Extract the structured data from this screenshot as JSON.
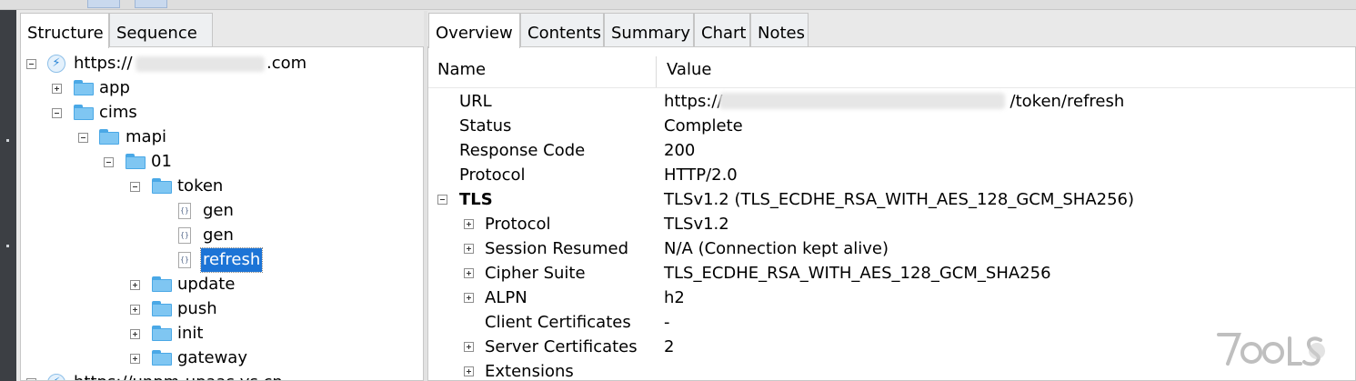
{
  "left_tabs": [
    {
      "label": "Structure",
      "active": true
    },
    {
      "label": "Sequence",
      "active": false
    }
  ],
  "right_tabs": [
    {
      "label": "Overview",
      "active": true
    },
    {
      "label": "Contents",
      "active": false
    },
    {
      "label": "Summary",
      "active": false
    },
    {
      "label": "Chart",
      "active": false
    },
    {
      "label": "Notes",
      "active": false
    }
  ],
  "tree": {
    "host_prefix": "https://",
    "host_suffix": ".com",
    "nodes": [
      {
        "label": "app",
        "type": "folder",
        "state": "collapsed"
      },
      {
        "label": "cims",
        "type": "folder",
        "state": "expanded"
      },
      {
        "label": "mapi",
        "type": "folder",
        "state": "expanded"
      },
      {
        "label": "01",
        "type": "folder",
        "state": "expanded"
      },
      {
        "label": "token",
        "type": "folder",
        "state": "expanded"
      },
      {
        "label": "gen",
        "type": "file"
      },
      {
        "label": "gen",
        "type": "file"
      },
      {
        "label": "refresh",
        "type": "file",
        "selected": true
      },
      {
        "label": "update",
        "type": "folder",
        "state": "collapsed"
      },
      {
        "label": "push",
        "type": "folder",
        "state": "collapsed"
      },
      {
        "label": "init",
        "type": "folder",
        "state": "collapsed"
      },
      {
        "label": "gateway",
        "type": "folder",
        "state": "collapsed"
      }
    ],
    "next_host": "https://unpm-upaas.ys.cn"
  },
  "columns": {
    "name": "Name",
    "value": "Value"
  },
  "overview": {
    "url_prefix": "https://",
    "url_suffix": "/token/refresh",
    "rows": [
      {
        "name": "URL"
      },
      {
        "name": "Status",
        "value": "Complete"
      },
      {
        "name": "Response Code",
        "value": "200"
      },
      {
        "name": "Protocol",
        "value": "HTTP/2.0"
      },
      {
        "name": "TLS",
        "value": "TLSv1.2 (TLS_ECDHE_RSA_WITH_AES_128_GCM_SHA256)",
        "bold": true,
        "expander": "minus"
      },
      {
        "name": "Protocol",
        "value": "TLSv1.2",
        "expander": "plus"
      },
      {
        "name": "Session Resumed",
        "value": "N/A (Connection kept alive)",
        "expander": "plus"
      },
      {
        "name": "Cipher Suite",
        "value": "TLS_ECDHE_RSA_WITH_AES_128_GCM_SHA256",
        "expander": "plus"
      },
      {
        "name": "ALPN",
        "value": "h2",
        "expander": "plus"
      },
      {
        "name": "Client Certificates",
        "value": "-"
      },
      {
        "name": "Server Certificates",
        "value": "2",
        "expander": "plus"
      },
      {
        "name": "Extensions",
        "value": "",
        "expander": "plus"
      }
    ]
  },
  "watermark": "7OOLS",
  "colors": {
    "selection": "#1c74d6",
    "folder": "#7fc6f2",
    "panel_border": "#c8c8c8"
  },
  "icons": [
    "lightning-icon",
    "folder-icon",
    "file-icon",
    "expand-icon",
    "collapse-icon"
  ]
}
